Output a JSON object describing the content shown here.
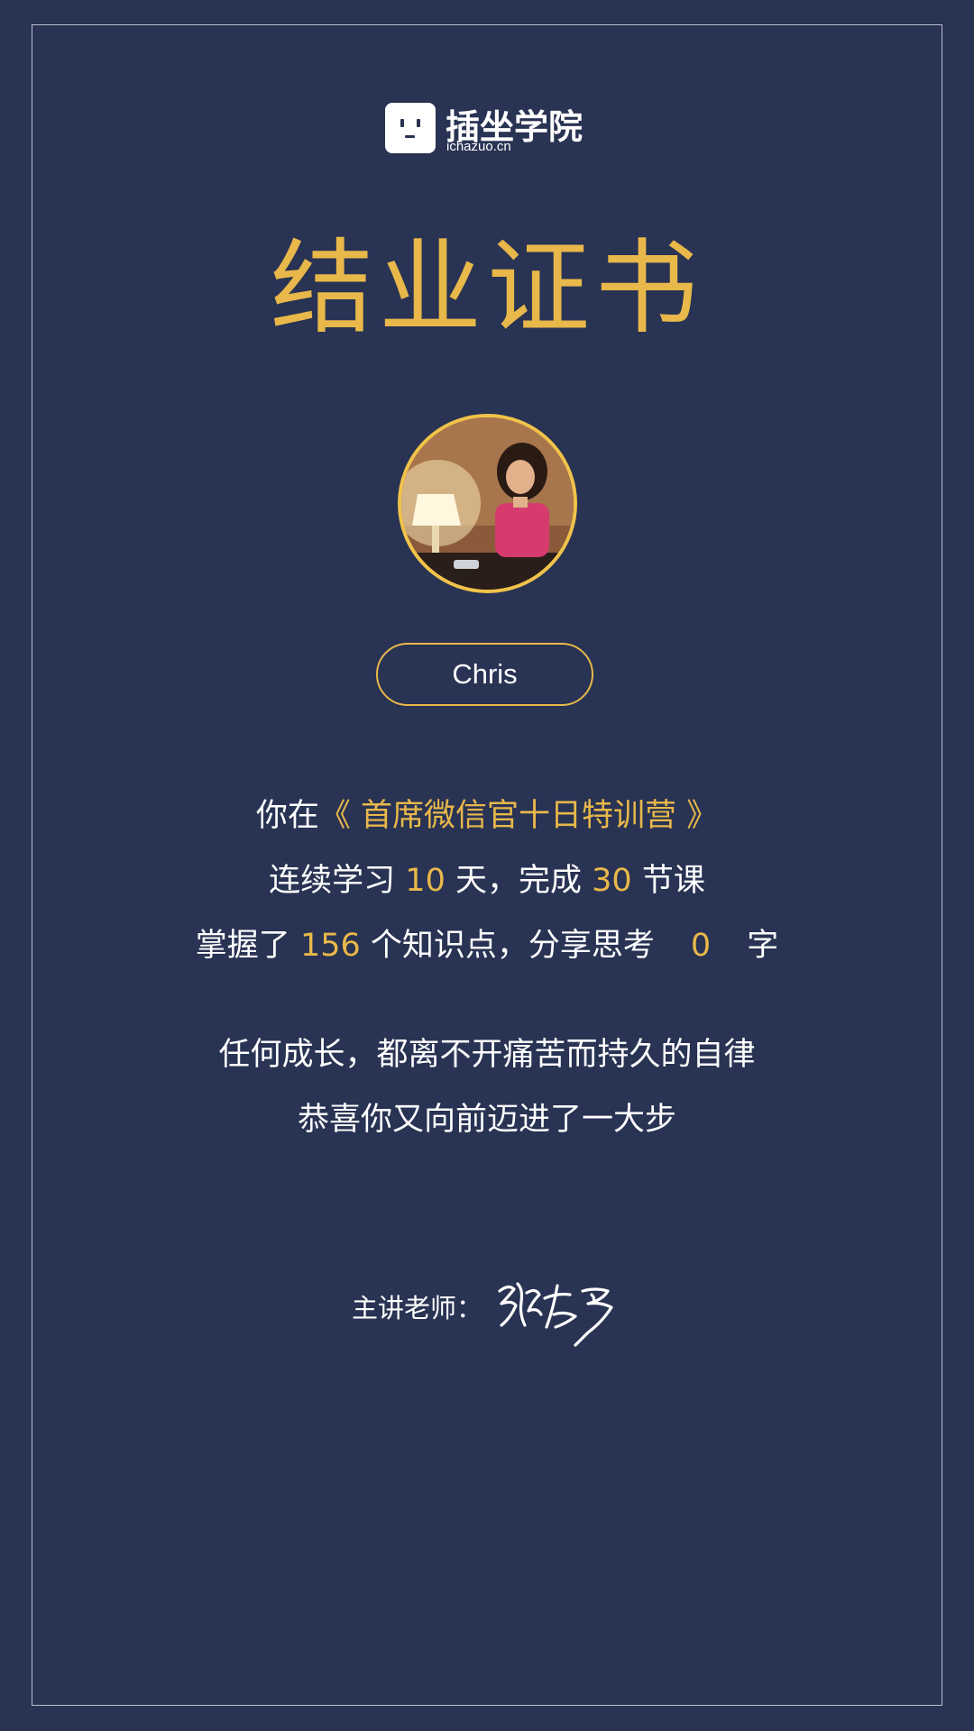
{
  "brand": {
    "name": "插坐学院",
    "url": "ichazuo.cn",
    "logo_icon": "smiley-square-icon"
  },
  "certificate": {
    "title": "结业证书",
    "student_name": "Chris"
  },
  "summary": {
    "line1_prefix": "你在",
    "course": "《 首席微信官十日特训营 》",
    "line2_prefix": "连续学习",
    "days": "10",
    "line2_mid": "天，完成",
    "lessons": "30",
    "line2_suffix": "节课",
    "line3_prefix": "掌握了",
    "knowledge_points": "156",
    "line3_mid": "个知识点，分享思考",
    "words": "0",
    "line3_suffix": "字"
  },
  "motto": {
    "line1": "任何成长，都离不开痛苦而持久的自律",
    "line2": "恭喜你又向前迈进了一大步"
  },
  "teacher": {
    "label": "主讲老师：",
    "signature": "张左罗"
  },
  "colors": {
    "background": "#293353",
    "accent": "#e8b84a",
    "text": "#ffffff",
    "frame": "#b9bfd0"
  }
}
